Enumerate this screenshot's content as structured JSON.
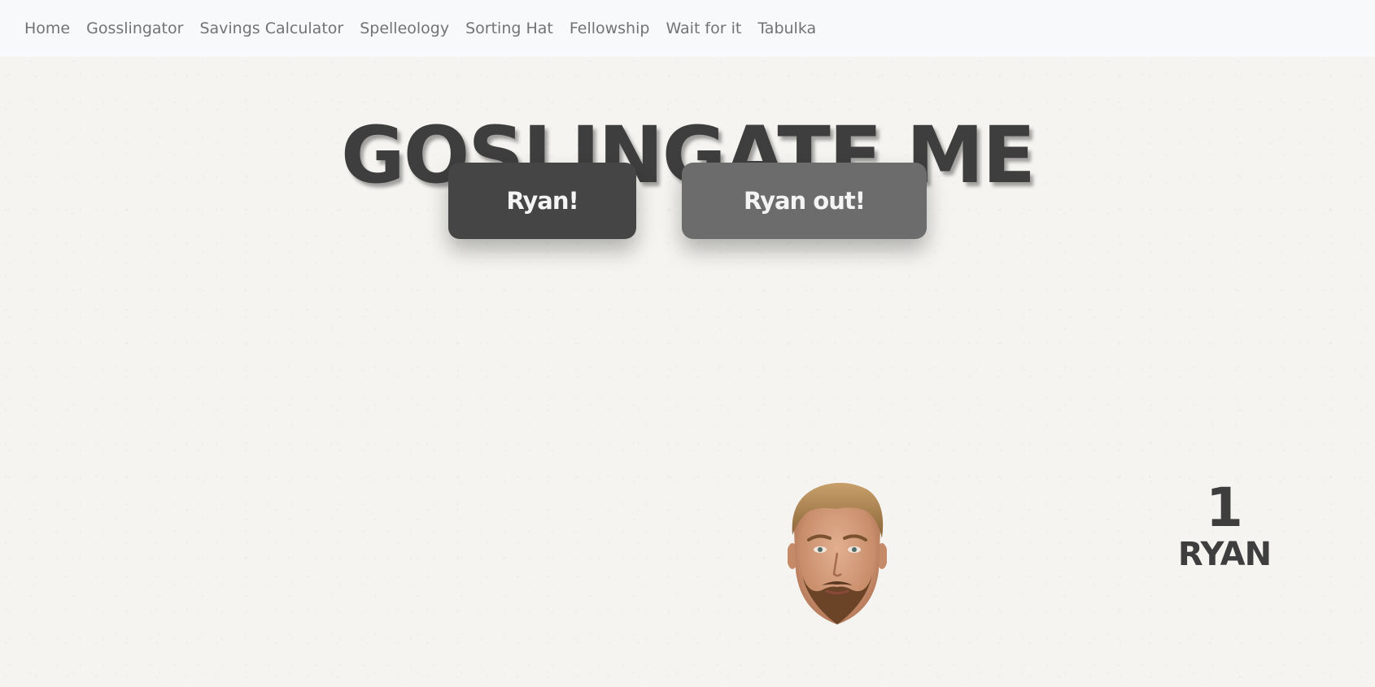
{
  "nav": {
    "items": [
      {
        "label": "Home"
      },
      {
        "label": "Gosslingator"
      },
      {
        "label": "Savings Calculator"
      },
      {
        "label": "Spelleology"
      },
      {
        "label": "Sorting Hat"
      },
      {
        "label": "Fellowship"
      },
      {
        "label": "Wait for it"
      },
      {
        "label": "Tabulka"
      }
    ]
  },
  "main": {
    "title": "GOSLINGATE ME",
    "buttons": {
      "add_label": "Ryan!",
      "remove_label": "Ryan out!"
    },
    "counter": {
      "value": "1",
      "label": "RYAN"
    }
  },
  "colors": {
    "text_dark": "#3e3e3e",
    "add_button": "#454545",
    "remove_button": "#6c6c6c",
    "navbar_bg": "#f8f9fa",
    "page_bg": "#f5f4f1"
  }
}
